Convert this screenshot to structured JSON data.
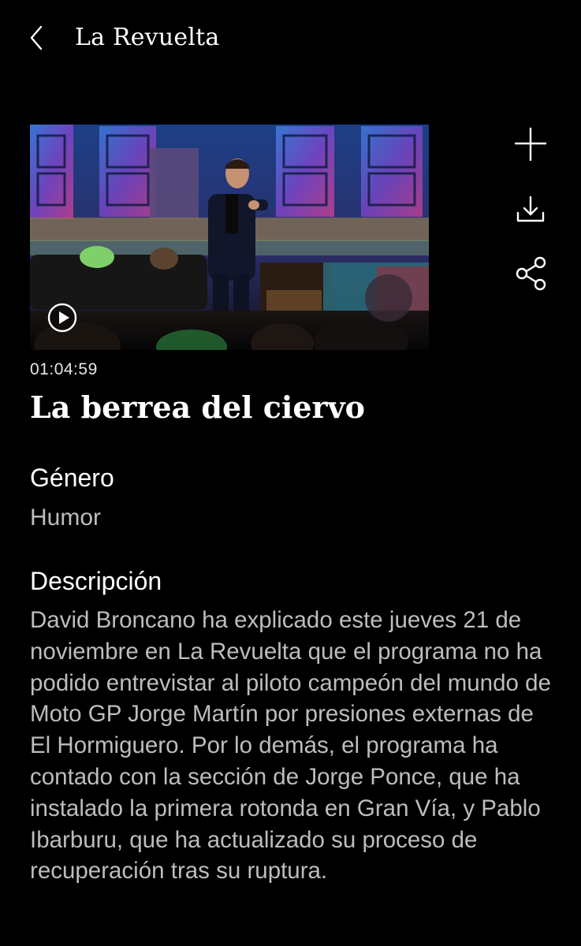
{
  "header": {
    "title": "La Revuelta",
    "back_icon": "chevron-left-icon"
  },
  "episode": {
    "duration": "01:04:59",
    "title": "La berrea del ciervo",
    "play_icon": "play-circle-icon"
  },
  "actions": [
    {
      "name": "add-button",
      "icon": "plus-icon"
    },
    {
      "name": "download-button",
      "icon": "download-icon"
    },
    {
      "name": "share-button",
      "icon": "share-icon"
    }
  ],
  "genre": {
    "label": "Género",
    "value": "Humor"
  },
  "description": {
    "label": "Descripción",
    "text": "David Broncano ha explicado este jueves 21 de noviembre en La Revuelta que el programa no ha podido entrevistar al piloto campeón del mundo de Moto GP Jorge Martín por presiones externas de El Hormiguero. Por lo demás, el programa ha contado con la sección de Jorge Ponce, que ha instalado la primera rotonda en Gran Vía, y Pablo Ibarburu, que ha actualizado su proceso de recuperación tras su ruptura."
  },
  "colors": {
    "background": "#000000",
    "primary_text": "#ffffff",
    "secondary_text": "#bdbdbd"
  }
}
